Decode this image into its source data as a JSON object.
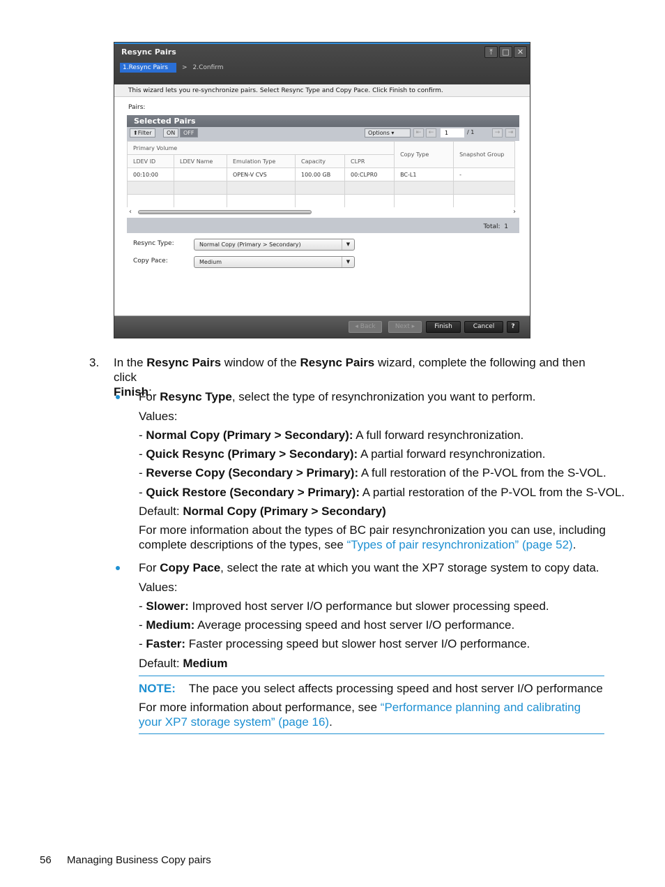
{
  "window": {
    "title": "Resync Pairs",
    "controls": [
      "pin-icon",
      "maximize-icon",
      "close-icon"
    ],
    "steps": [
      {
        "label": "1.Resync Pairs",
        "active": true
      },
      {
        "label": "2.Confirm",
        "active": false
      }
    ],
    "step_separator": ">",
    "description": "This wizard lets you re-synchronize pairs. Select Resync Type and Copy Pace. Click Finish to confirm.",
    "pairs_label": "Pairs:",
    "selected_pairs": {
      "title": "Selected Pairs",
      "toolbar": {
        "filter_label": "Filter",
        "on_label": "ON",
        "off_label": "OFF",
        "options_label": "Options",
        "page_value": "1",
        "page_total": "/ 1"
      },
      "group_header": "Primary Volume",
      "columns": [
        "LDEV ID",
        "LDEV Name",
        "Emulation Type",
        "Capacity",
        "CLPR",
        "Copy Type",
        "Snapshot Group"
      ],
      "rows": [
        [
          "00:10:00",
          "",
          "OPEN-V CVS",
          "100.00 GB",
          "00:CLPR0",
          "BC-L1",
          "-"
        ]
      ],
      "total_label": "Total:",
      "total_value": "1"
    },
    "resync_type": {
      "label": "Resync Type:",
      "value": "Normal Copy (Primary > Secondary)"
    },
    "copy_pace": {
      "label": "Copy Pace:",
      "value": "Medium"
    },
    "footer": {
      "back": "Back",
      "next": "Next",
      "finish": "Finish",
      "cancel": "Cancel",
      "help": "?"
    }
  },
  "doc": {
    "step_number": "3.",
    "step_text": {
      "p1": "In the ",
      "b1": "Resync Pairs",
      "p2": " window of the ",
      "b2": "Resync Pairs",
      "p3": " wizard, complete the following and then click",
      "b3": "Finish",
      "p4": ":"
    },
    "resync_bullet": {
      "p1": "For ",
      "b1": "Resync Type",
      "p2": ", select the type of resynchronization you want to perform.",
      "values_label": "Values:",
      "values": [
        {
          "name": "Normal Copy (Primary > Secondary):",
          "desc": " A full forward resynchronization."
        },
        {
          "name": "Quick Resync (Primary > Secondary):",
          "desc": " A partial forward resynchronization."
        },
        {
          "name": "Reverse Copy (Secondary > Primary):",
          "desc": " A full restoration of the P-VOL from the S-VOL."
        },
        {
          "name": "Quick Restore (Secondary > Primary):",
          "desc": " A partial restoration of the P-VOL from the S-VOL."
        }
      ],
      "default_label": "Default: ",
      "default_value": "Normal Copy (Primary > Secondary)",
      "more_info_line1": "For more information about the types of BC pair resynchronization you can use, including",
      "more_info_line2": "complete descriptions of the types, see ",
      "more_info_link": "“Types of pair resynchronization” (page 52)",
      "more_info_end": "."
    },
    "pace_bullet": {
      "p1": "For ",
      "b1": "Copy Pace",
      "p2": ", select the rate at which you want the XP7 storage system to copy data.",
      "values_label": "Values:",
      "values": [
        {
          "name": "Slower:",
          "desc": " Improved host server I/O performance but slower processing speed."
        },
        {
          "name": "Medium:",
          "desc": " Average processing speed and host server I/O performance."
        },
        {
          "name": "Faster:",
          "desc": " Faster processing speed but slower host server I/O performance."
        }
      ],
      "default_label": "Default: ",
      "default_value": "Medium"
    },
    "note": {
      "label": "NOTE:",
      "text": "The pace you select affects processing speed and host server I/O performance",
      "more_line1": "For more information about performance, see ",
      "link_line1": "“Performance planning and calibrating",
      "link_line2": "your XP7 storage system” (page 16)",
      "end": "."
    },
    "colors": {
      "accent": "#1e90d2",
      "wizard_step_active": "#2a6fd6"
    }
  },
  "footer": {
    "page_number": "56",
    "section_title": "Managing Business Copy pairs"
  }
}
